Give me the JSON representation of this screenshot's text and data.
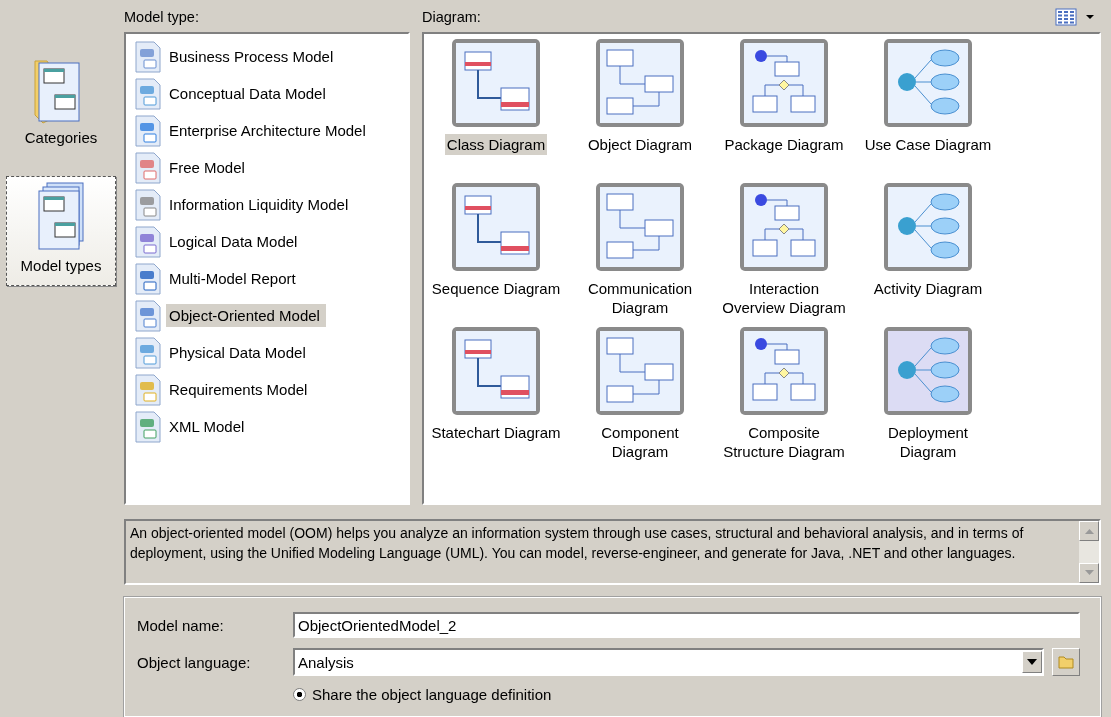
{
  "categories_bar": {
    "items": [
      {
        "label": "Categories",
        "selected": false
      },
      {
        "label": "Model types",
        "selected": true
      }
    ]
  },
  "model_type": {
    "label": "Model type:",
    "items": [
      {
        "label": "Business Process Model",
        "selected": false
      },
      {
        "label": "Conceptual Data Model",
        "selected": false
      },
      {
        "label": "Enterprise Architecture Model",
        "selected": false
      },
      {
        "label": "Free Model",
        "selected": false
      },
      {
        "label": "Information Liquidity Model",
        "selected": false
      },
      {
        "label": "Logical Data Model",
        "selected": false
      },
      {
        "label": "Multi-Model Report",
        "selected": false
      },
      {
        "label": "Object-Oriented Model",
        "selected": true
      },
      {
        "label": "Physical Data Model",
        "selected": false
      },
      {
        "label": "Requirements Model",
        "selected": false
      },
      {
        "label": "XML Model",
        "selected": false
      }
    ]
  },
  "diagram": {
    "label": "Diagram:",
    "items": [
      {
        "lines": [
          "Class Diagram"
        ],
        "selected": true
      },
      {
        "lines": [
          "Object Diagram"
        ],
        "selected": false
      },
      {
        "lines": [
          "Package Diagram"
        ],
        "selected": false
      },
      {
        "lines": [
          "Use Case Diagram"
        ],
        "selected": false
      },
      {
        "lines": [
          "Sequence Diagram"
        ],
        "selected": false
      },
      {
        "lines": [
          "Communication",
          "Diagram"
        ],
        "selected": false
      },
      {
        "lines": [
          "Interaction",
          "Overview Diagram"
        ],
        "selected": false
      },
      {
        "lines": [
          "Activity Diagram"
        ],
        "selected": false
      },
      {
        "lines": [
          "Statechart Diagram"
        ],
        "selected": false
      },
      {
        "lines": [
          "Component",
          "Diagram"
        ],
        "selected": false
      },
      {
        "lines": [
          "Composite",
          "Structure Diagram"
        ],
        "selected": false
      },
      {
        "lines": [
          "Deployment",
          "Diagram"
        ],
        "selected": false
      }
    ]
  },
  "description": "An object-oriented model (OOM) helps you analyze an information system through use cases, structural and behavioral analysis, and in terms of deployment, using the Unified Modeling Language (UML). You can model, reverse-engineer, and generate for Java, .NET and other languages.",
  "form": {
    "model_name": {
      "label": "Model name:",
      "value": "ObjectOrientedModel_2"
    },
    "object_language": {
      "label": "Object language:",
      "value": "Analysis"
    },
    "share_option": {
      "label": "Share the object language definition",
      "selected": true
    }
  }
}
